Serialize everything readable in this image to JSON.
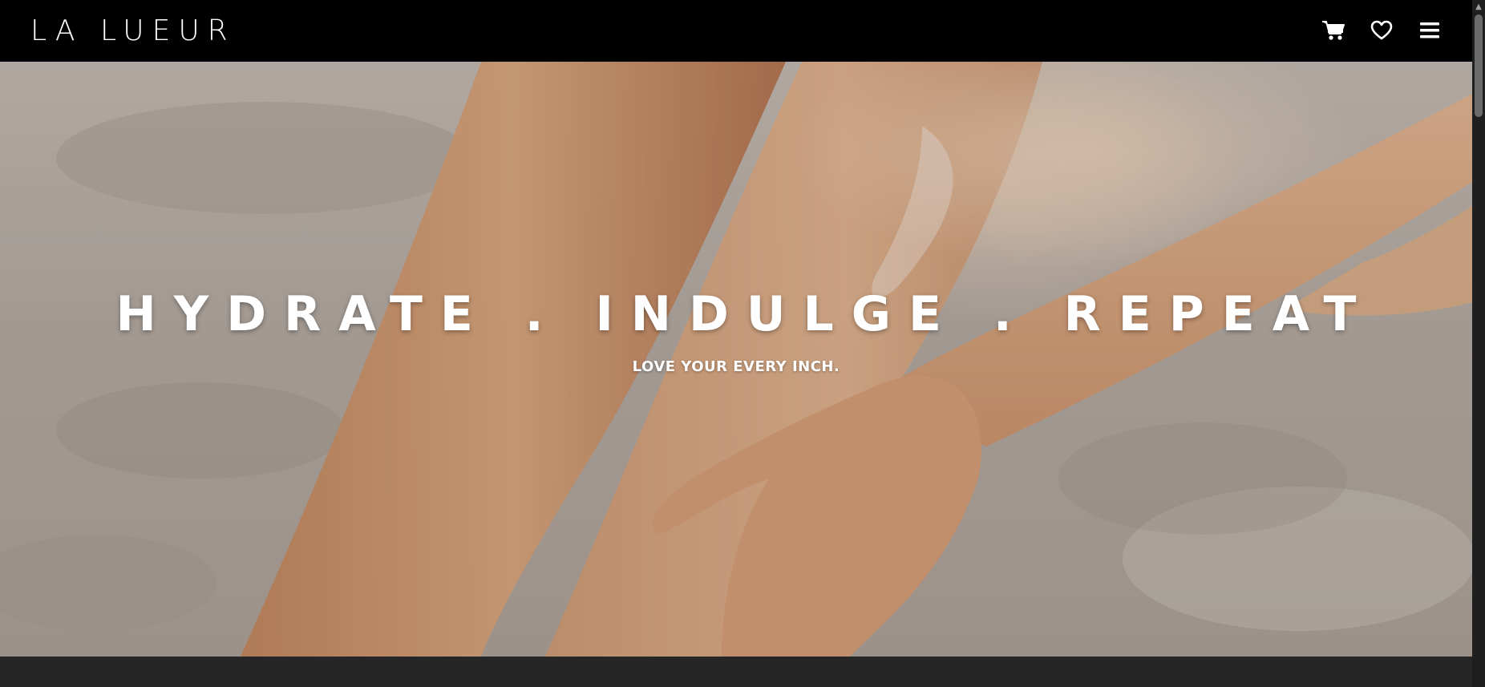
{
  "header": {
    "brand": "LA LUEUR",
    "icons": [
      "cart-icon",
      "heart-icon",
      "menu-icon"
    ]
  },
  "hero": {
    "headline": "HYDRATE . INDULGE . REPEAT",
    "tagline": "LOVE YOUR EVERY INCH."
  },
  "colors": {
    "navbar": "#000000",
    "text": "#ffffff",
    "footer": "#262626",
    "skin": "#d59a70",
    "sand": "#bdb3aa"
  }
}
